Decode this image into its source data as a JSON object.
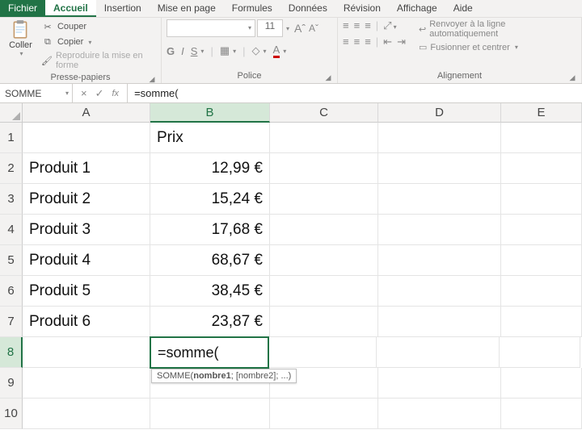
{
  "menu": {
    "file": "Fichier",
    "home": "Accueil",
    "insert": "Insertion",
    "layout": "Mise en page",
    "formulas": "Formules",
    "data": "Données",
    "review": "Révision",
    "view": "Affichage",
    "help": "Aide"
  },
  "ribbon": {
    "clipboard": {
      "paste": "Coller",
      "cut": "Couper",
      "copy": "Copier",
      "format_painter": "Reproduire la mise en forme",
      "label": "Presse-papiers"
    },
    "font": {
      "name_placeholder": "",
      "size": "11",
      "grow": "Aˆ",
      "shrink": "Aˇ",
      "bold": "G",
      "italic": "I",
      "underline": "S",
      "label": "Police"
    },
    "alignment": {
      "wrap": "Renvoyer à la ligne automatiquement",
      "merge": "Fusionner et centrer",
      "label": "Alignement"
    }
  },
  "fx": {
    "name_box": "SOMME",
    "cancel": "×",
    "enter": "✓",
    "fx": "fx",
    "formula": "=somme("
  },
  "columns": [
    "A",
    "B",
    "C",
    "D",
    "E"
  ],
  "rows": [
    "1",
    "2",
    "3",
    "4",
    "5",
    "6",
    "7",
    "8",
    "9",
    "10"
  ],
  "sheet": {
    "b1": "Prix",
    "a2": "Produit 1",
    "b2": "12,99 €",
    "a3": "Produit 2",
    "b3": "15,24 €",
    "a4": "Produit 3",
    "b4": "17,68 €",
    "a5": "Produit 4",
    "b5": "68,67 €",
    "a6": "Produit 5",
    "b6": "38,45 €",
    "a7": "Produit 6",
    "b7": "23,87 €",
    "b8": "=somme("
  },
  "tooltip": {
    "fn": "SOMME(",
    "arg1": "nombre1",
    "rest": "; [nombre2]; ...)"
  },
  "active": {
    "col": "B",
    "row": "8"
  },
  "chart_data": {
    "type": "table",
    "title": "Prix",
    "categories": [
      "Produit 1",
      "Produit 2",
      "Produit 3",
      "Produit 4",
      "Produit 5",
      "Produit 6"
    ],
    "values": [
      12.99,
      15.24,
      17.68,
      68.67,
      38.45,
      23.87
    ],
    "currency": "€"
  }
}
